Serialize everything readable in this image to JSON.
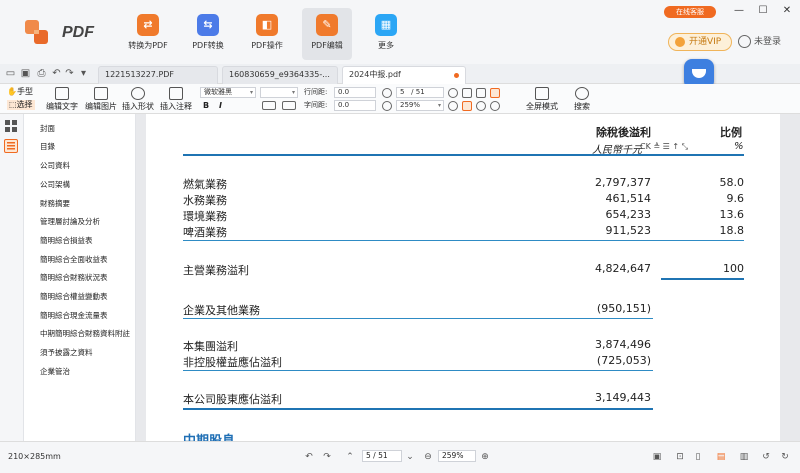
{
  "app": {
    "name": "PDF",
    "service_badge": "在线客服",
    "vip": "开通VIP",
    "login": "未登录"
  },
  "tools": [
    "转换为PDF",
    "PDF转换",
    "PDF操作",
    "PDF编辑",
    "更多"
  ],
  "tabs": [
    {
      "label": "1221513227.PDF"
    },
    {
      "label": "160830659_e9364335-..."
    },
    {
      "label": "2024中报.pdf",
      "active": true
    }
  ],
  "edit_toolbar": {
    "hand": "手型",
    "select": "选择",
    "edit_text": "编辑文字",
    "edit_image": "编辑图片",
    "insert_shape": "插入形状",
    "insert_note": "插入注释",
    "font": "微软雅黑",
    "line_spacing_label": "行间距:",
    "line_spacing": "0.0",
    "char_spacing_label": "字间距:",
    "char_spacing": "0.0",
    "bold": "B",
    "italic": "I",
    "page_current": "5",
    "page_total": "/ 51",
    "zoom": "259%",
    "fullscreen": "全屏模式",
    "search": "搜索"
  },
  "sidebar": [
    "封面",
    "目錄",
    "公司資料",
    "公司架構",
    "財務摘要",
    "管理層討論及分析",
    "簡明綜合損益表",
    "簡明綜合全面收益表",
    "簡明綜合財務狀況表",
    "簡明綜合權益變動表",
    "簡明綜合現金流量表",
    "中期簡明綜合財務資料附註",
    "須予披露之資料",
    "企業管治"
  ],
  "document": {
    "header_profit": "除稅後溢利",
    "header_ratio": "比例",
    "currency": "人民幣千元",
    "percent": "%",
    "rows": [
      {
        "label": "燃氣業務",
        "value": "2,797,377",
        "ratio": "58.0"
      },
      {
        "label": "水務業務",
        "value": "461,514",
        "ratio": "9.6"
      },
      {
        "label": "環境業務",
        "value": "654,233",
        "ratio": "13.6"
      },
      {
        "label": "啤酒業務",
        "value": "911,523",
        "ratio": "18.8"
      }
    ],
    "main_profit_label": "主營業務溢利",
    "main_profit": "4,824,647",
    "main_ratio": "100",
    "other_label": "企業及其他業務",
    "other_value": "(950,151)",
    "group_label": "本集團溢利",
    "group_value": "3,874,496",
    "minority_label": "非控股權益應佔溢利",
    "minority_value": "(725,053)",
    "shareholders_label": "本公司股東應佔溢利",
    "shareholders_value": "3,149,443",
    "next_heading": "中期股息"
  },
  "status": {
    "page_size": "210×285mm",
    "page_current": "5",
    "page_total": "/ 51",
    "zoom": "259%"
  }
}
